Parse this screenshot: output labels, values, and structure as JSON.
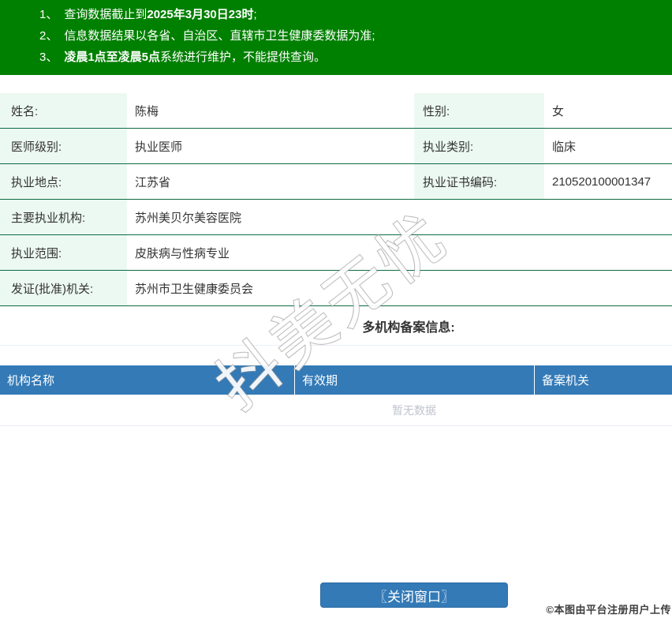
{
  "colors": {
    "notice_bg": "#008000",
    "row_border": "#0d6b43",
    "label_bg": "#ecf9f2",
    "text": "#333333",
    "header_blue": "#337ab7",
    "button_blue": "#337ab7",
    "button_border": "#2d6da3",
    "empty_text": "#c0c4cc",
    "light_border": "#ebeef5"
  },
  "notice": {
    "lines": [
      {
        "num": "1、",
        "pre": "查询数据截止到",
        "bold": "2025年3月30日23时",
        "post": ";"
      },
      {
        "num": "2、",
        "pre": "信息数据结果以各省、自治区、直辖市卫生健康委数据为准;",
        "bold": "",
        "post": ""
      },
      {
        "num": "3、",
        "pre": "",
        "bold": "凌晨1点至凌晨5点",
        "post": "系统进行维护，不能提供查询。"
      }
    ]
  },
  "profile": {
    "rows": [
      {
        "label1": "姓名:",
        "value1": "陈梅",
        "label2": "性别:",
        "value2": "女"
      },
      {
        "label1": "医师级别:",
        "value1": "执业医师",
        "label2": "执业类别:",
        "value2": "临床"
      },
      {
        "label1": "执业地点:",
        "value1": "江苏省",
        "label2": "执业证书编码:",
        "value2": "210520100001347"
      },
      {
        "label1": "主要执业机构:",
        "value1": "苏州美贝尔美容医院"
      },
      {
        "label1": "执业范围:",
        "value1": "皮肤病与性病专业"
      },
      {
        "label1": "发证(批准)机关:",
        "value1": "苏州市卫生健康委员会"
      }
    ]
  },
  "filing": {
    "heading": "多机构备案信息:",
    "columns": [
      "机构名称",
      "有效期",
      "备案机关"
    ],
    "empty_text": "暂无数据"
  },
  "footer": {
    "close_button": "〖关闭窗口〗"
  },
  "watermark": {
    "text": "抖美无忧"
  },
  "attribution": "©本图由平台注册用户上传"
}
